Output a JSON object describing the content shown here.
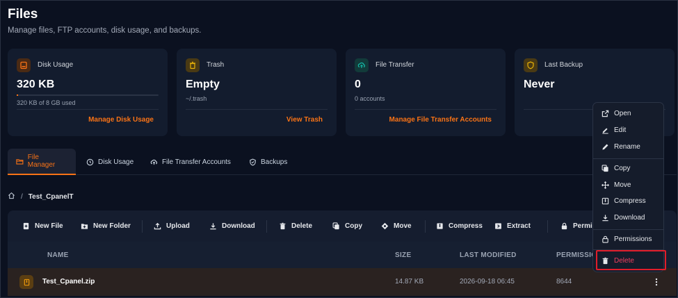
{
  "header": {
    "title": "Files",
    "subtitle": "Manage files, FTP accounts, disk usage, and backups."
  },
  "cards": [
    {
      "label": "Disk Usage",
      "value": "320 KB",
      "sub": "320 KB of 8 GB used",
      "action": "Manage Disk Usage",
      "icon": "hard-drive-icon",
      "accent": "#f97316",
      "usage_fraction": 4e-05
    },
    {
      "label": "Trash",
      "value": "Empty",
      "sub": "~/.trash",
      "action": "View Trash",
      "icon": "trash-icon",
      "accent": "#eab308"
    },
    {
      "label": "File Transfer",
      "value": "0",
      "sub": "0 accounts",
      "action": "Manage File Transfer Accounts",
      "icon": "cloud-upload-icon",
      "accent": "#14b8a6"
    },
    {
      "label": "Last Backup",
      "value": "Never",
      "icon": "shield-icon",
      "accent": "#eab308"
    }
  ],
  "tabs": [
    {
      "label": "File Manager",
      "active": true
    },
    {
      "label": "Disk Usage"
    },
    {
      "label": "File Transfer Accounts"
    },
    {
      "label": "Backups"
    }
  ],
  "breadcrumb": {
    "separator": "/",
    "current": "Test_CpanelT"
  },
  "toolbar": {
    "new_file": "New File",
    "new_folder": "New Folder",
    "upload": "Upload",
    "download": "Download",
    "delete": "Delete",
    "copy": "Copy",
    "move": "Move",
    "compress": "Compress",
    "extract": "Extract",
    "permissions": "Permis"
  },
  "table": {
    "columns": {
      "name": "NAME",
      "size": "SIZE",
      "modified": "LAST MODIFIED",
      "permissions": "PERMISSIO"
    },
    "rows": [
      {
        "name": "Test_Cpanel.zip",
        "size": "14.87 KB",
        "modified": "2026-09-18 06:45",
        "permissions": "8644"
      }
    ]
  },
  "context_menu": {
    "items": [
      {
        "label": "Open",
        "icon": "external-link-icon"
      },
      {
        "label": "Edit",
        "icon": "edit-icon"
      },
      {
        "label": "Rename",
        "icon": "pencil-icon"
      },
      {
        "label": "Copy",
        "icon": "copy-icon"
      },
      {
        "label": "Move",
        "icon": "move-icon"
      },
      {
        "label": "Compress",
        "icon": "archive-icon"
      },
      {
        "label": "Download",
        "icon": "download-icon"
      },
      {
        "label": "Permissions",
        "icon": "lock-icon"
      },
      {
        "label": "Delete",
        "icon": "trash-icon",
        "highlighted": true
      }
    ]
  },
  "colors": {
    "accent": "#f97316",
    "danger": "#f43f5e",
    "highlight_border": "#e11d2a",
    "background": "#0b1120"
  }
}
